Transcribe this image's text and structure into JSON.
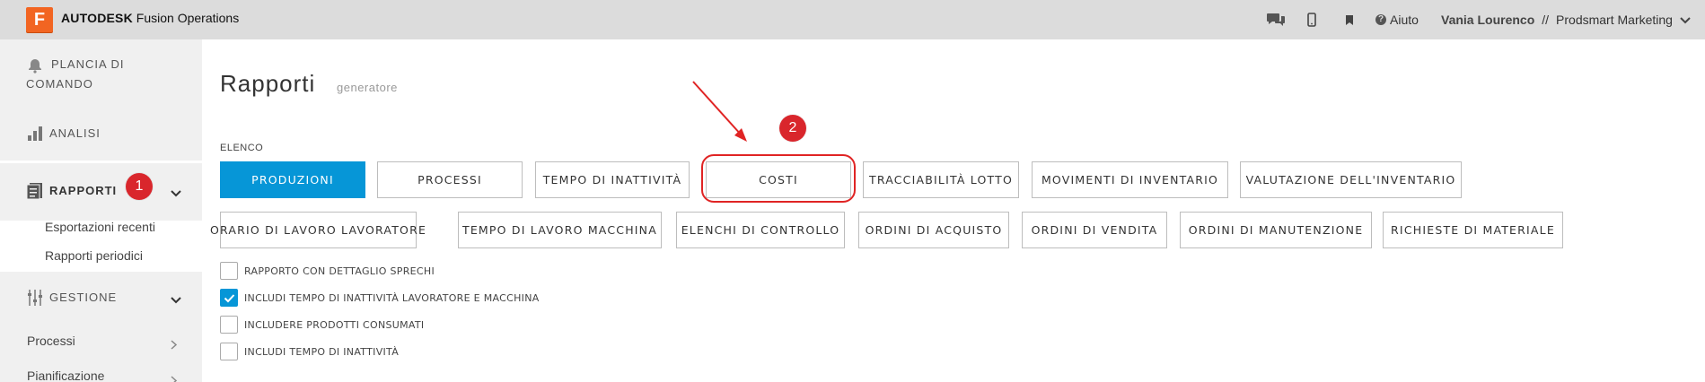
{
  "topbar": {
    "logo_letter": "F",
    "brand_bold": "AUTODESK",
    "brand_product": "Fusion Operations",
    "icons": [
      "chat-icon",
      "mobile-icon",
      "bookmark-icon"
    ],
    "help_label": "Aiuto",
    "user_name": "Vania Lourenco",
    "separator": "//",
    "company": "Prodsmart Marketing"
  },
  "sidebar": {
    "dashboard_label_1": "PLANCIA DI",
    "dashboard_label_2": "COMANDO",
    "analysis_label": "ANALISI",
    "reports_label": "RAPPORTI",
    "reports_sub": [
      "Esportazioni recenti",
      "Rapporti periodici"
    ],
    "management_label": "GESTIONE",
    "management_sub": [
      "Processi",
      "Pianificazione"
    ]
  },
  "annotations": {
    "badge1": "1",
    "badge2": "2",
    "accent_color": "#e02424"
  },
  "main": {
    "title": "Rapporti",
    "subtitle": "generatore",
    "section_label": "ELENCO",
    "row1": [
      "PRODUZIONI",
      "PROCESSI",
      "TEMPO DI INATTIVITÀ",
      "COSTI",
      "TRACCIABILITÀ LOTTO",
      "MOVIMENTI DI INVENTARIO",
      "VALUTAZIONE DELL'INVENTARIO"
    ],
    "row2": [
      "ORARIO DI LAVORO LAVORATORE",
      "TEMPO DI LAVORO MACCHINA",
      "ELENCHI DI CONTROLLO",
      "ORDINI DI ACQUISTO",
      "ORDINI DI VENDITA",
      "ORDINI DI MANUTENZIONE",
      "RICHIESTE DI MATERIALE"
    ],
    "active_button": "PRODUZIONI",
    "active_color": "#0696d7",
    "options": [
      {
        "label": "RAPPORTO CON DETTAGLIO SPRECHI",
        "checked": false
      },
      {
        "label": "INCLUDI TEMPO DI INATTIVITÀ LAVORATORE E MACCHINA",
        "checked": true
      },
      {
        "label": "INCLUDERE PRODOTTI CONSUMATI",
        "checked": false
      },
      {
        "label": "INCLUDI TEMPO DI INATTIVITÀ",
        "checked": false
      }
    ]
  }
}
